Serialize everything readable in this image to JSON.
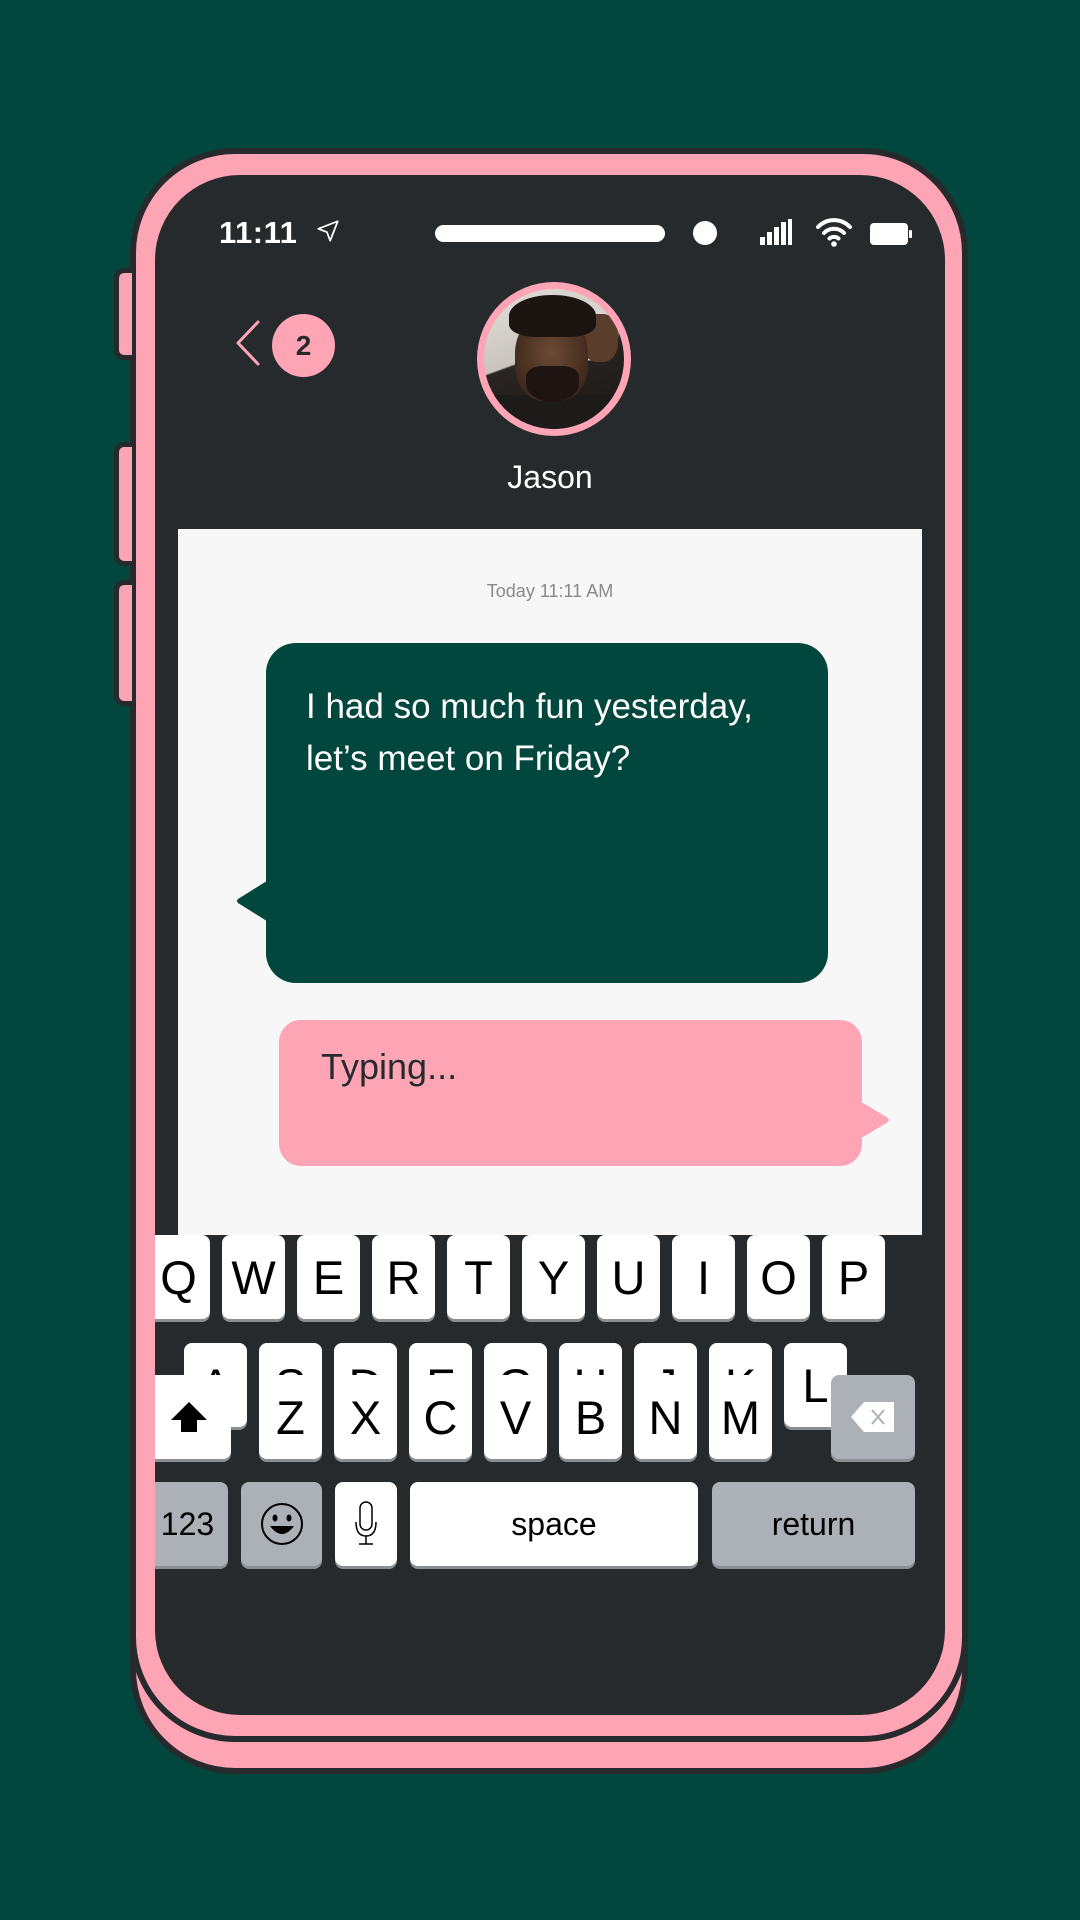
{
  "status_bar": {
    "time": "11:11",
    "icons": [
      "location-arrow-icon",
      "signal-icon",
      "wifi-icon",
      "battery-icon"
    ]
  },
  "header": {
    "back_icon": "chevron-left-icon",
    "unread_count": "2",
    "contact_name": "Jason",
    "avatar": "avatar-photo"
  },
  "chat": {
    "timestamp": "Today 11:11 AM",
    "messages": [
      {
        "direction": "incoming",
        "text": "I had so much fun yesterday, let’s meet on Friday?"
      },
      {
        "direction": "outgoing",
        "text": "Typing..."
      }
    ]
  },
  "keyboard": {
    "row1": [
      "Q",
      "W",
      "E",
      "R",
      "T",
      "Y",
      "U",
      "I",
      "O",
      "P"
    ],
    "row2": [
      "A",
      "S",
      "D",
      "F",
      "G",
      "H",
      "J",
      "K",
      "L"
    ],
    "row3": [
      "Z",
      "X",
      "C",
      "V",
      "B",
      "N",
      "M"
    ],
    "shift_icon": "shift-arrow-icon",
    "delete_icon": "backspace-icon",
    "numbers_label": "123",
    "emoji_icon": "emoji-icon",
    "mic_icon": "microphone-icon",
    "space_label": "space",
    "return_label": "return"
  },
  "colors": {
    "background": "#02473d",
    "accent_pink": "#fda5b5",
    "screen_dark": "#272a2c",
    "chat_bg": "#f7f7f7",
    "incoming_bubble": "#02473d",
    "key_gray": "#acb1b8"
  }
}
